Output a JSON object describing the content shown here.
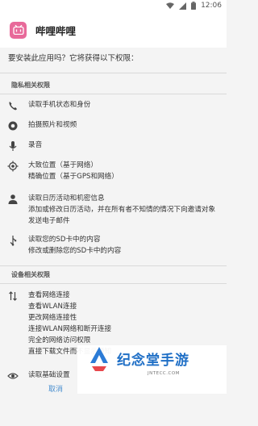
{
  "status": {
    "time": "12:06",
    "icons": [
      "wifi-icon",
      "signal-icon",
      "battery-icon"
    ]
  },
  "app": {
    "name": "哔哩哔哩",
    "icon_glyph": "bili",
    "icon_color": "#e86a9a"
  },
  "intro": "要安装此应用吗？它将获得以下权限：",
  "privacy": {
    "title": "隐私相关权限",
    "items": [
      {
        "icon": "phone-icon",
        "lines": [
          "读取手机状态和身份"
        ]
      },
      {
        "icon": "camera-icon",
        "lines": [
          "拍摄照片和视频"
        ]
      },
      {
        "icon": "microphone-icon",
        "lines": [
          "录音"
        ]
      },
      {
        "icon": "location-icon",
        "lines": [
          "大致位置（基于网络）",
          "精确位置（基于GPS和网络）"
        ]
      },
      {
        "icon": "person-icon",
        "lines": [
          "读取日历活动和机密信息",
          "添加或修改日历活动，并在所有者不知情的情况下向邀请对象发送电子邮件"
        ]
      },
      {
        "icon": "usb-icon",
        "lines": [
          "读取您的SD卡中的内容",
          "修改或删除您的SD卡中的内容"
        ]
      }
    ]
  },
  "device": {
    "title": "设备相关权限",
    "items": [
      {
        "icon": "network-arrows-icon",
        "lines": [
          "查看网络连接",
          "查看WLAN连接",
          "更改网络连接性",
          "连接WLAN网络和断开连接",
          "完全的网络访问权限",
          "直接下载文件而不显示通知"
        ]
      },
      {
        "icon": "eye-icon",
        "lines": [
          "读取基础设置"
        ]
      }
    ]
  },
  "buttons": {
    "cancel": "取消"
  },
  "watermark": {
    "title": "纪念堂手游",
    "sub": "JNTECC.COM"
  }
}
